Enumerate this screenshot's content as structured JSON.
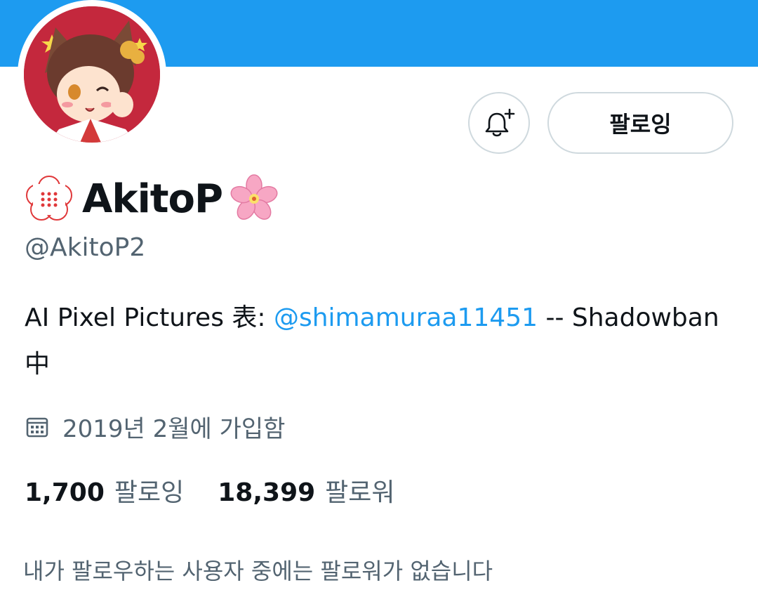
{
  "header": {
    "banner_color": "#1d9bf0"
  },
  "profile": {
    "avatar": "avatar-image",
    "display_name": "AkitoP",
    "name_prefix_icon": "crest-icon",
    "name_suffix_icon": "cherry-blossom-icon",
    "handle": "@AkitoP2",
    "bio_prefix": "AI Pixel Pictures 表: ",
    "bio_mention": "@shimamuraa11451",
    "bio_suffix": " -- Shadowban中",
    "joined_icon": "calendar-icon",
    "joined": "2019년 2월에 가입함"
  },
  "actions": {
    "notify_icon": "bell-plus-icon",
    "follow_label": "팔로잉"
  },
  "stats": {
    "following_count": "1,700",
    "following_label": "팔로잉",
    "followers_count": "18,399",
    "followers_label": "팔로워"
  },
  "followers_you_know": "내가 팔로우하는 사용자 중에는 팔로워가 없습니다",
  "colors": {
    "accent": "#1d9bf0",
    "text": "#0f1419",
    "muted": "#536471",
    "border": "#cfd9de"
  }
}
